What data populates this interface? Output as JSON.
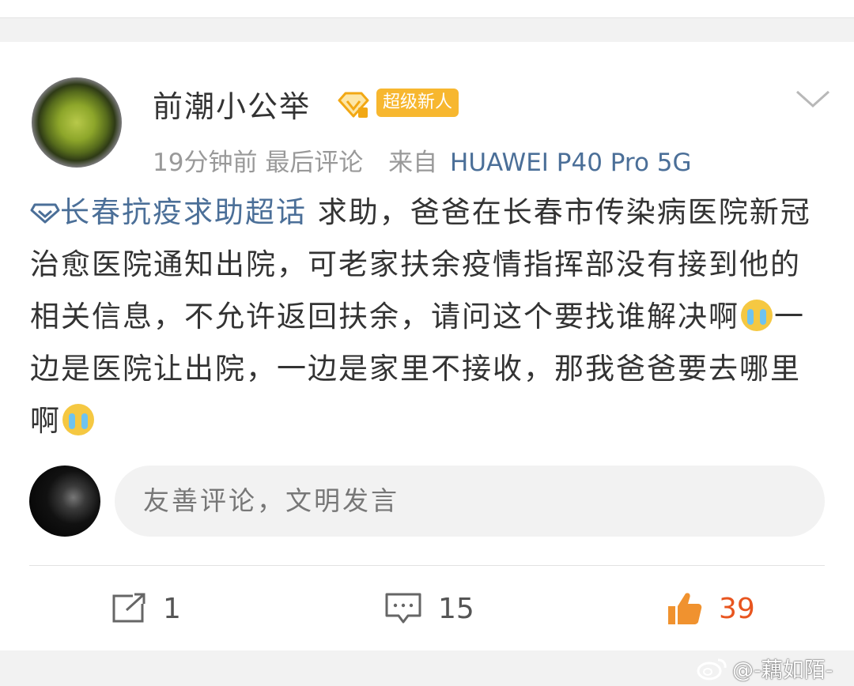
{
  "post": {
    "author": {
      "name": "前潮小公举",
      "badge": "超级新人",
      "avatar_icon": "green-tea-cup"
    },
    "time": "19分钟前",
    "last_comment_label": "最后评论",
    "source_prefix": "来自",
    "device": "HUAWEI P40 Pro 5G",
    "topic": "长春抗疫求助超话",
    "content_part1": "求助，爸爸在长春市传染病医院新冠治愈医院通知出院，可老家扶余疫情指挥部没有接到他的相关信息，不允许返回扶余，请问这个要找谁解决啊",
    "content_part2": "一边是医院让出院，一边是家里不接收，那我爸爸要去哪里啊",
    "emoji_name": "crying-emoji"
  },
  "comment_box": {
    "placeholder": "友善评论，文明发言"
  },
  "actions": {
    "repost_count": "1",
    "comment_count": "15",
    "like_count": "39"
  },
  "watermark": {
    "text": "@-藕如陌-"
  },
  "colors": {
    "link": "#4b6f98",
    "like": "#e8551f",
    "badge": "#f7b72f"
  }
}
